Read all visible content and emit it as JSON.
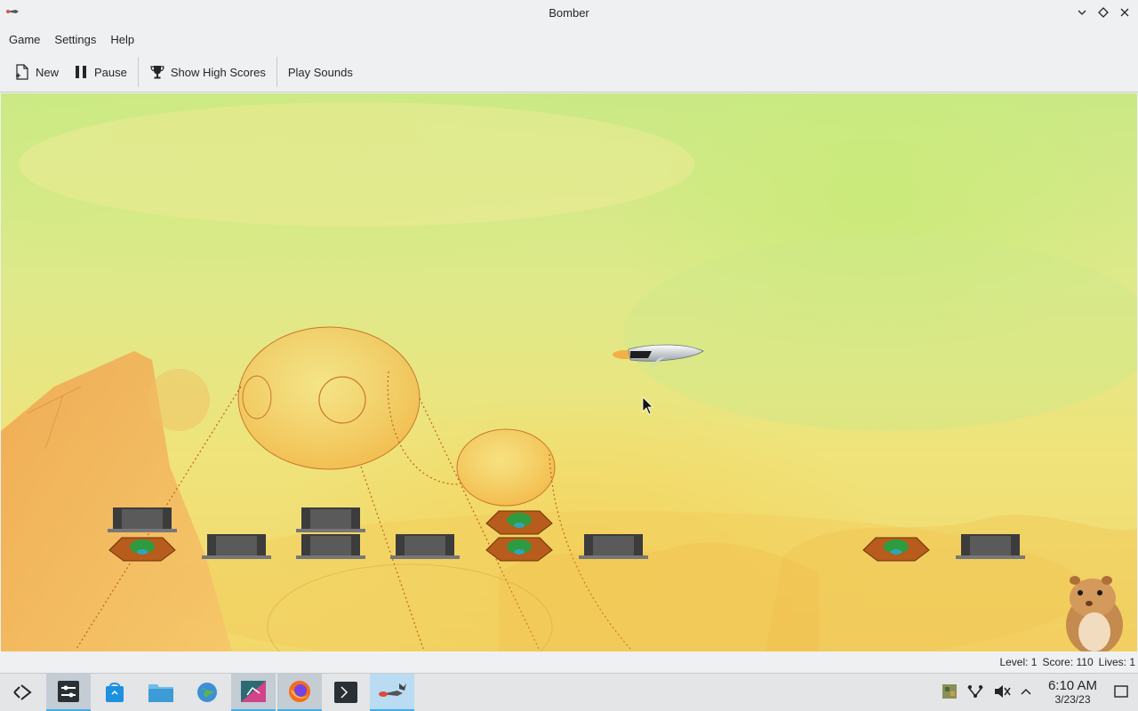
{
  "window": {
    "title": "Bomber",
    "controls": [
      "minimize",
      "maximize",
      "close"
    ]
  },
  "menubar": {
    "items": [
      "Game",
      "Settings",
      "Help"
    ]
  },
  "toolbar": {
    "new_label": "New",
    "pause_label": "Pause",
    "high_scores_label": "Show High Scores",
    "sounds_label": "Play Sounds"
  },
  "statusbar": {
    "level": "Level: 1",
    "score": "Score: 110",
    "lives": "Lives: 1"
  },
  "taskbar": {
    "launcher_icon": "application-launcher-icon",
    "apps": [
      {
        "name": "system-settings-icon",
        "active": true
      },
      {
        "name": "discover-icon",
        "active": false
      },
      {
        "name": "file-manager-icon",
        "active": false
      },
      {
        "name": "browser-globe-icon",
        "active": false
      },
      {
        "name": "kde-app-icon",
        "active": true
      },
      {
        "name": "firefox-icon",
        "active": true
      },
      {
        "name": "terminal-icon",
        "active": false
      },
      {
        "name": "bomber-icon",
        "active": true
      }
    ],
    "tray_icons": [
      "steam-game-icon",
      "network-icon",
      "volume-muted-icon",
      "show-hidden-icon"
    ],
    "time": "6:10 AM",
    "date": "3/23/23",
    "show_desktop_icon": "show-desktop-icon"
  },
  "colors": {
    "accent": "#3daee9",
    "sky_top": "#c9e985",
    "sky_bottom": "#f3d76a"
  }
}
